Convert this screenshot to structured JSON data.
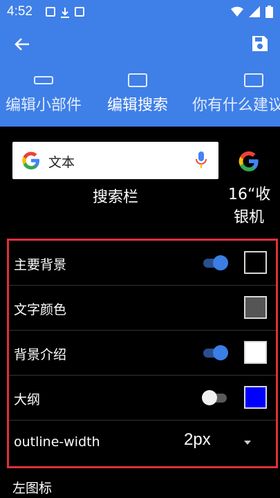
{
  "status_bar": {
    "time": "4:52"
  },
  "tabs": [
    {
      "label": "编辑小部件",
      "active": false
    },
    {
      "label": "编辑搜索",
      "active": true
    },
    {
      "label": "你有什么建议",
      "active": false
    }
  ],
  "preview": {
    "search_text": "文本",
    "search_caption": "搜索栏",
    "side_widget_text": "16“收银机"
  },
  "settings": [
    {
      "label": "主要背景",
      "toggle": true,
      "toggle_on": true,
      "swatch_color": "#000000"
    },
    {
      "label": "文字颜色",
      "toggle": false,
      "swatch_color": "#555555"
    },
    {
      "label": "背景介绍",
      "toggle": true,
      "toggle_on": true,
      "swatch_color": "#ffffff"
    },
    {
      "label": "大纲",
      "toggle": true,
      "toggle_on": false,
      "swatch_color": "#0000ff"
    },
    {
      "label": "outline-width",
      "dropdown_value": "2px"
    }
  ],
  "next_row": {
    "label": "左图标"
  },
  "colors": {
    "primary": "#3f7fe8",
    "toggle_on": "#3a7ee6",
    "highlight_border": "#e0303a"
  },
  "icons": {
    "back": "arrow-left-icon",
    "save": "floppy-disk-icon",
    "mic": "microphone-icon",
    "google": "google-g-icon"
  }
}
